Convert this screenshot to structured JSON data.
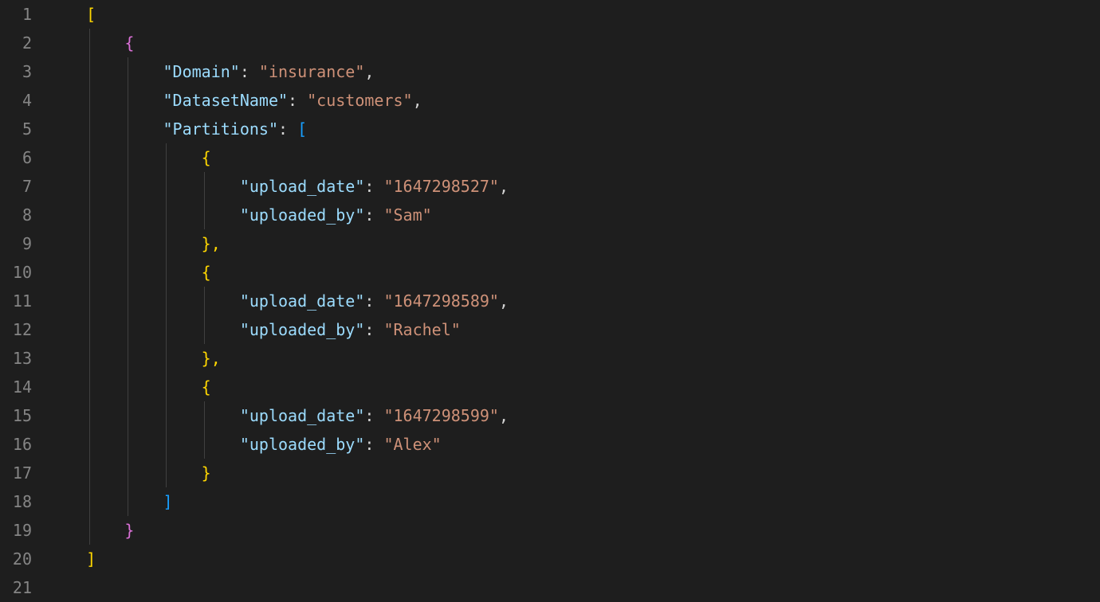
{
  "lines": {
    "l1": "1",
    "l2": "2",
    "l3": "3",
    "l4": "4",
    "l5": "5",
    "l6": "6",
    "l7": "7",
    "l8": "8",
    "l9": "9",
    "l10": "10",
    "l11": "11",
    "l12": "12",
    "l13": "13",
    "l14": "14",
    "l15": "15",
    "l16": "16",
    "l17": "17",
    "l18": "18",
    "l19": "19",
    "l20": "20",
    "l21": "21"
  },
  "json": {
    "keys": {
      "domain": "\"Domain\"",
      "datasetName": "\"DatasetName\"",
      "partitions": "\"Partitions\"",
      "upload_date": "\"upload_date\"",
      "uploaded_by": "\"uploaded_by\""
    },
    "values": {
      "domain": "\"insurance\"",
      "datasetName": "\"customers\"",
      "p0_date": "\"1647298527\"",
      "p0_by": "\"Sam\"",
      "p1_date": "\"1647298589\"",
      "p1_by": "\"Rachel\"",
      "p2_date": "\"1647298599\"",
      "p2_by": "\"Alex\""
    },
    "tokens": {
      "open_sq": "[",
      "close_sq": "]",
      "open_br": "{",
      "close_br": "}",
      "close_br_comma": "},",
      "colon": ": ",
      "comma": ","
    }
  }
}
